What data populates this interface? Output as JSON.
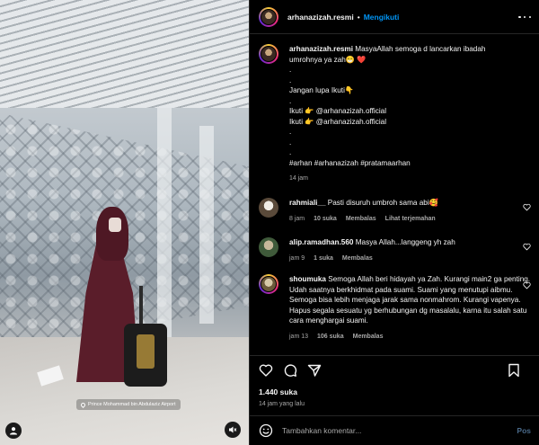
{
  "media": {
    "location": "Prince Mohammad bin Abdulaziz Airport"
  },
  "header": {
    "username": "arhanazizah.resmi",
    "separator": "•",
    "follow_label": "Mengikuti"
  },
  "caption": {
    "username": "arhanazizah.resmi",
    "lines": [
      "MasyaAllah semoga d lancarkan ibadah",
      "umrohnya ya zah😁 ❤️",
      ".",
      ".",
      "Jangan lupa Ikuti👇",
      ".",
      "Ikuti 👉 @arhanazizah.official",
      "Ikuti 👉 @arhanazizah.official",
      ".",
      ".",
      ".",
      "#arhan #arhanazizah #pratamaarhan"
    ],
    "time": "14 jam"
  },
  "comments": [
    {
      "username": "rahmiali__",
      "text": "Pasti disuruh umbroh sama abi🥰",
      "time": "8 jam",
      "likes": "10 suka",
      "reply": "Membalas",
      "translate": "Lihat terjemahan"
    },
    {
      "username": "alip.ramadhan.560",
      "text": "Masya Allah...langgeng yh zah",
      "time": "jam 9",
      "likes": "1 suka",
      "reply": "Membalas"
    },
    {
      "username": "shoumuka",
      "text": "Semoga Allah beri hidayah ya Zah. Kurangi main2 ga penting. Udah saatnya berkhidmat pada suami. Suami yang menutupi aibmu. Semoga bisa lebih menjaga jarak sama nonmahrom. Kurangi vapenya. Hapus segala sesuatu yg berhubungan dg masalalu, karna itu salah satu cara menghargai suami.",
      "time": "jam 13",
      "likes": "106 suka",
      "reply": "Membalas"
    }
  ],
  "likes_count": "1.440 suka",
  "post_time": "14 jam yang lalu",
  "add_comment": {
    "placeholder": "Tambahkan komentar...",
    "post_label": "Pos"
  }
}
